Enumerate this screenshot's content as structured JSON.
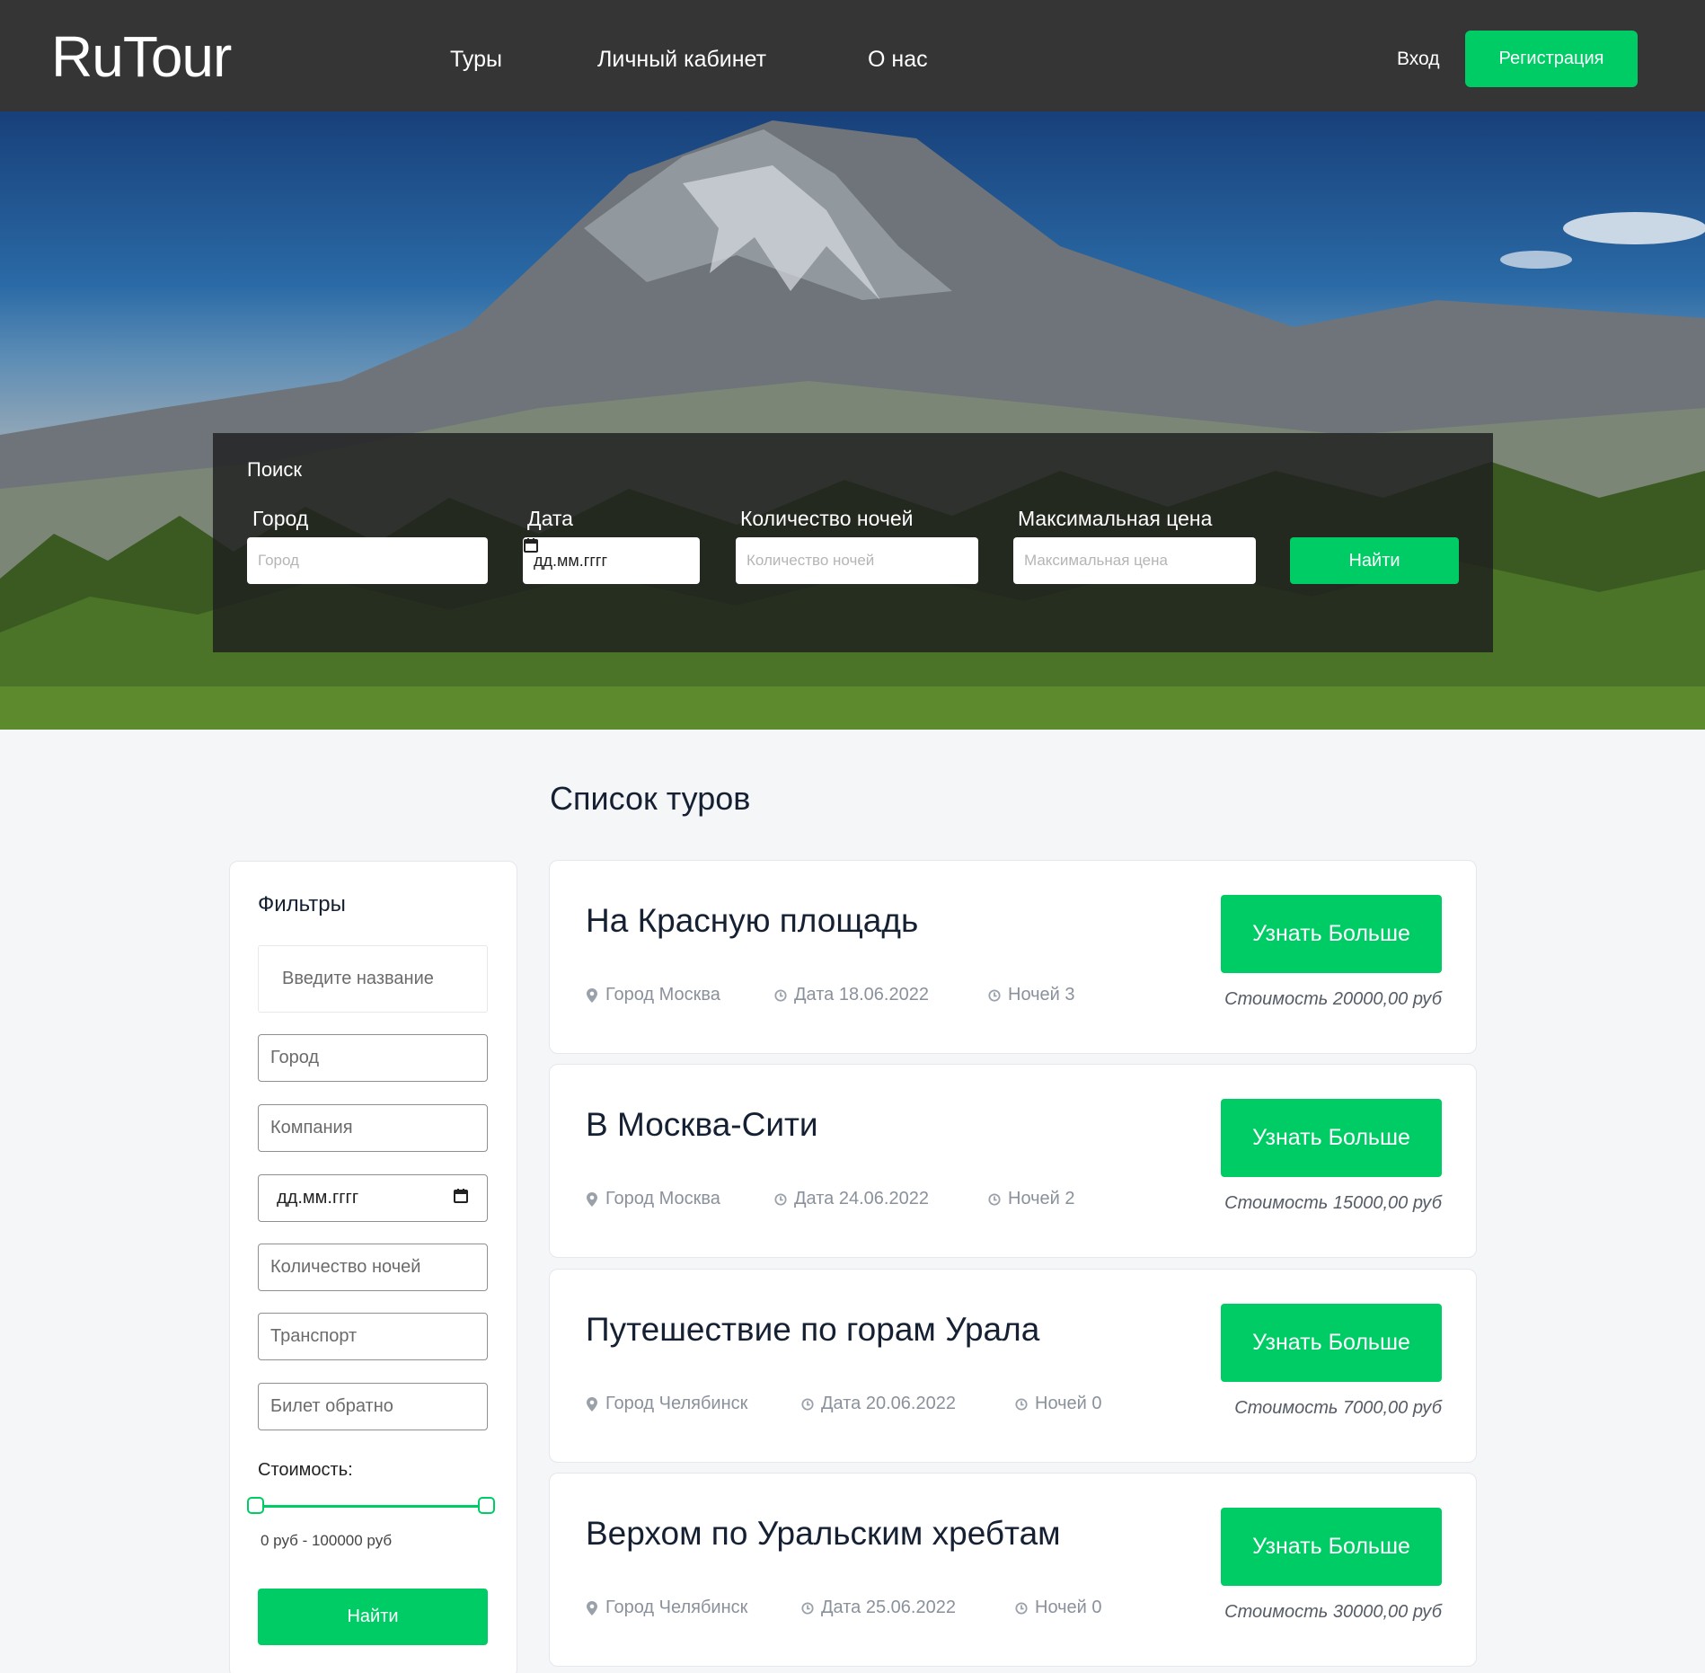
{
  "header": {
    "logo": "RuTour",
    "nav": [
      "Туры",
      "Личный кабинет",
      "О нас"
    ],
    "login": "Вход",
    "register": "Регистрация"
  },
  "search": {
    "title": "Поиск",
    "city_label": "Город",
    "city_placeholder": "Город",
    "date_label": "Дата",
    "date_value": "дд.мм.гггг",
    "nights_label": "Количество ночей",
    "nights_placeholder": "Количество ночей",
    "price_label": "Максимальная цена",
    "price_placeholder": "Максимальная цена",
    "button": "Найти"
  },
  "section_title": "Список туров",
  "filters": {
    "title": "Фильтры",
    "name_placeholder": "Введите название",
    "city": "Город",
    "company": "Компания",
    "date": "дд.мм.гггг",
    "nights": "Количество ночей",
    "transport": "Транспорт",
    "return_ticket": "Билет обратно",
    "cost_label": "Стоимость:",
    "cost_min": 0,
    "cost_max": 100000,
    "range_text": "0 руб - 100000 руб",
    "button": "Найти"
  },
  "tours": [
    {
      "title": "На Красную площадь",
      "city": "Город Москва",
      "date": "Дата 18.06.2022",
      "nights": "Ночей 3",
      "button": "Узнать Больше",
      "price": "Стоимость 20000,00 руб"
    },
    {
      "title": "В Москва-Сити",
      "city": "Город Москва",
      "date": "Дата 24.06.2022",
      "nights": "Ночей 2",
      "button": "Узнать Больше",
      "price": "Стоимость 15000,00 руб"
    },
    {
      "title": "Путешествие по горам Урала",
      "city": "Город Челябинск",
      "date": "Дата 20.06.2022",
      "nights": "Ночей 0",
      "button": "Узнать Больше",
      "price": "Стоимость 7000,00 руб"
    },
    {
      "title": "Верхом по Уральским хребтам",
      "city": "Город Челябинск",
      "date": "Дата 25.06.2022",
      "nights": "Ночей 0",
      "button": "Узнать Больше",
      "price": "Стоимость 30000,00 руб"
    }
  ],
  "icons": {
    "location": "map-marker-icon",
    "date": "clock-icon",
    "nights": "clock-icon",
    "calendar": "calendar-icon"
  },
  "colors": {
    "accent": "#00cc66",
    "header_bg": "#353535",
    "page_bg": "#f5f6f8"
  }
}
